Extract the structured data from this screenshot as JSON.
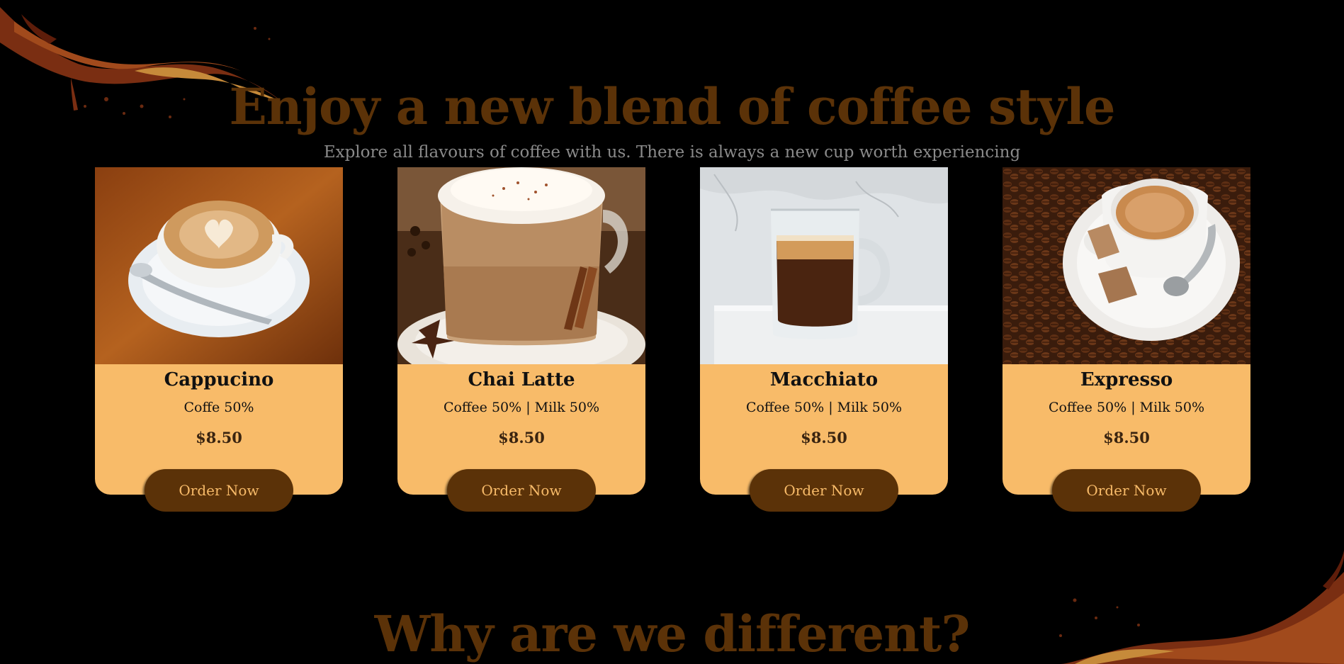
{
  "hero": {
    "title": "Enjoy a new blend of coffee style",
    "subtitle": "Explore all flavours of coffee with us. There is always a new cup worth experiencing"
  },
  "products": [
    {
      "name": "Cappucino",
      "description": "Coffe 50%",
      "price": "$8.50",
      "button": "Order Now",
      "image": "cappuccino-latte-art-image"
    },
    {
      "name": "Chai Latte",
      "description": "Coffee 50% | Milk 50%",
      "price": "$8.50",
      "button": "Order Now",
      "image": "chai-latte-glass-image"
    },
    {
      "name": "Macchiato",
      "description": "Coffee 50% | Milk 50%",
      "price": "$8.50",
      "button": "Order Now",
      "image": "macchiato-glass-image"
    },
    {
      "name": "Expresso",
      "description": "Coffee 50% | Milk 50%",
      "price": "$8.50",
      "button": "Order Now",
      "image": "espresso-cup-beans-image"
    }
  ],
  "section2": {
    "title": "Why are we different?"
  },
  "colors": {
    "background": "#000000",
    "brand_brown": "#5b3208",
    "card_bg": "#f8bb69",
    "subtitle_gray": "#8a8a8a"
  }
}
